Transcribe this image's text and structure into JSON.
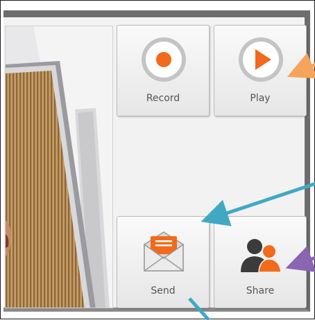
{
  "controls": {
    "record_label": "Record",
    "play_label": "Play",
    "send_label": "Send",
    "share_label": "Share"
  },
  "icons": {
    "record": "record-icon",
    "play": "play-icon",
    "send": "envelope-icon",
    "share": "users-icon"
  },
  "colors": {
    "accent": "#f26a1b",
    "frame": "#6d6d6d",
    "annotation_orange": "#f5a45a",
    "annotation_teal": "#3fa9c4",
    "annotation_purple": "#8a65b2"
  }
}
